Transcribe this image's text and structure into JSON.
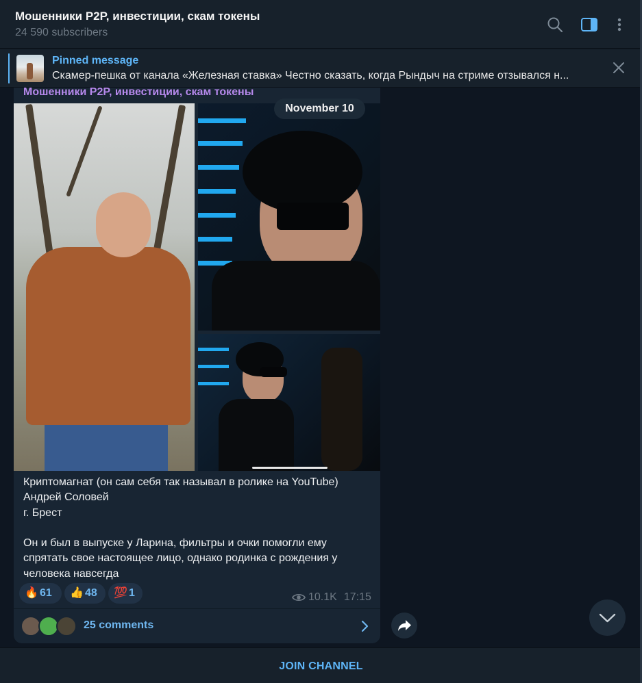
{
  "header": {
    "title": "Мошенники P2P, инвестиции, скам токены",
    "subscribers": "24 590 subscribers",
    "icons": [
      "search-icon",
      "sidebar-toggle-icon",
      "more-vertical-icon"
    ]
  },
  "pinned": {
    "label": "Pinned message",
    "text": "Скамер-пешка от канала «Железная ставка»  Честно сказать, когда Рындыч на стриме отзывался н..."
  },
  "message": {
    "author": "Мошенники P2P, инвестиции, скам токены",
    "date": "November 10",
    "caption_lines": [
      "Криптомагнат (он сам себя так называл в ролике на YouTube)",
      "Андрей Соловей",
      "г. Брест",
      "",
      "Он и был в выпуске у Ларина, фильтры и очки помогли ему",
      "спрятать свое настоящее лицо, однако родинка с рождения у",
      "человека навсегда"
    ],
    "reactions": [
      {
        "emoji": "🔥",
        "count": "61"
      },
      {
        "emoji": "👍",
        "count": "48"
      },
      {
        "emoji": "💯",
        "count": "1"
      }
    ],
    "views": "10.1K",
    "time": "17:15",
    "comments_label": "25 comments"
  },
  "footer": {
    "join_label": "JOIN CHANNEL"
  },
  "colors": {
    "background": "#0e1621",
    "panel": "#17212b",
    "bubble": "#182533",
    "accent": "#5eb5f7",
    "author": "#b689ec"
  }
}
